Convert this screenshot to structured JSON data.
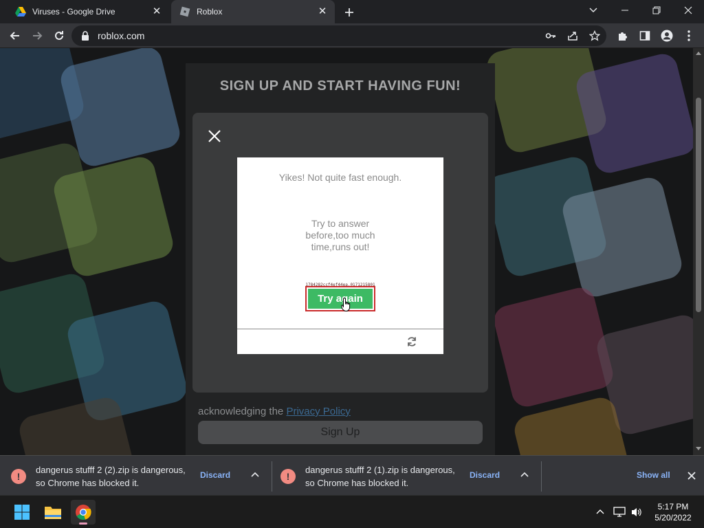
{
  "browser": {
    "tabs": [
      {
        "title": "Viruses - Google Drive",
        "icon": "google-drive-icon",
        "active": false
      },
      {
        "title": "Roblox",
        "icon": "roblox-icon",
        "active": true
      }
    ],
    "url": "roblox.com"
  },
  "page": {
    "headline": "SIGN UP AND START HAVING FUN!",
    "ack_text": "acknowledging the ",
    "privacy_link": "Privacy Policy",
    "signup_button": "Sign Up"
  },
  "captcha": {
    "title": "Yikes! Not quite fast enough.",
    "message": "Try to answer before,too much time,runs out!",
    "code": "1784282ccf4ef44ea.0171215801",
    "button": "Try again"
  },
  "downloads": [
    {
      "line1": "dangerus stufff 2 (2).zip is dangerous,",
      "line2": "so Chrome has blocked it.",
      "discard": "Discard"
    },
    {
      "line1": "dangerus stufff 2 (1).zip is dangerous,",
      "line2": "so Chrome has blocked it.",
      "discard": "Discard"
    }
  ],
  "shelf": {
    "show_all": "Show all"
  },
  "taskbar": {
    "time": "5:17 PM",
    "date": "5/20/2022"
  },
  "colors": {
    "accent_green": "#3dba64",
    "warning_red": "#f28b82",
    "link_blue": "#8ab4f8"
  }
}
